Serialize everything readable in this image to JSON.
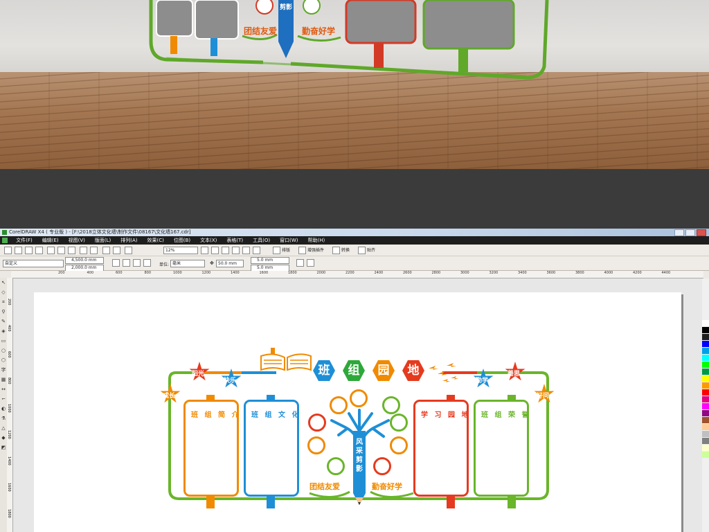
{
  "photo": {
    "slogan_left": "团结友爱",
    "slogan_right": "勤奋好学",
    "pencil_text": "剪影"
  },
  "app": {
    "title": "CorelDRAW X4 ( 专业版 ) - [F:\\2018立体文化墙\\制作文件\\08167\\文化墙167.cdr]",
    "menu": [
      "文件(F)",
      "编辑(E)",
      "视图(V)",
      "版面(L)",
      "排列(A)",
      "效果(C)",
      "位图(B)",
      "文本(X)",
      "表格(T)",
      "工具(O)",
      "窗口(W)",
      "帮助(H)"
    ],
    "zoom": "12%",
    "toolbar_labels": [
      "排版",
      "增强插件",
      "转换",
      "贴齐"
    ],
    "page_size_preset": "自定义",
    "page_width": "4,500.0 mm",
    "page_height": "2,000.0 mm",
    "units_label": "单位:",
    "units_value": "毫米",
    "nudge": "50.0 mm",
    "dup_x": "5.0 mm",
    "dup_y": "5.0 mm",
    "ruler_ticks": [
      "200",
      "400",
      "600",
      "800",
      "1000",
      "1200",
      "1400",
      "1600",
      "1800",
      "2000",
      "2200",
      "2400",
      "2600",
      "2800",
      "3000",
      "3200",
      "3400",
      "3600",
      "3800",
      "4000",
      "4200",
      "4400"
    ],
    "vruler_ticks": [
      "200",
      "400",
      "600",
      "800",
      "1000",
      "1200",
      "1400",
      "1600",
      "1800"
    ]
  },
  "design": {
    "heading": [
      "班",
      "组",
      "园",
      "地"
    ],
    "heading_colors": [
      "#1e8fd6",
      "#2ea83a",
      "#f08a00",
      "#e63a1e"
    ],
    "stars": [
      {
        "label": "成长",
        "color": "#f08a00"
      },
      {
        "label": "阳光",
        "color": "#e63a1e"
      },
      {
        "label": "快乐",
        "color": "#1e8fd6"
      },
      {
        "label": "勤学",
        "color": "#1e8fd6"
      },
      {
        "label": "善思",
        "color": "#e63a1e"
      },
      {
        "label": "好问",
        "color": "#f08a00"
      }
    ],
    "panels": [
      {
        "title": "班 组 简 介",
        "color": "#f08a00"
      },
      {
        "title": "班 组 文 化",
        "color": "#1e8fd6"
      },
      {
        "title": "学 习 园 地",
        "color": "#e63a1e"
      },
      {
        "title": "班 组 荣 誉",
        "color": "#6ab52a"
      }
    ],
    "pencil_text": [
      "风",
      "采",
      "剪",
      "影"
    ],
    "slogan_left": "团结友爱",
    "slogan_right": "勤奋好学",
    "colors": {
      "green": "#6ab52a",
      "orange": "#f08a00",
      "blue": "#1e8fd6",
      "red": "#e63a1e"
    }
  },
  "palette": [
    "#ffffff",
    "#000000",
    "#1e1e1e",
    "#0000ff",
    "#00a0e9",
    "#00ffff",
    "#00ff00",
    "#009944",
    "#ffff00",
    "#ff9900",
    "#ff0000",
    "#e4007f",
    "#ff00ff",
    "#920783",
    "#a0522d",
    "#ffcc99",
    "#c0c0c0",
    "#808080",
    "#ffffcc",
    "#ccff99"
  ]
}
